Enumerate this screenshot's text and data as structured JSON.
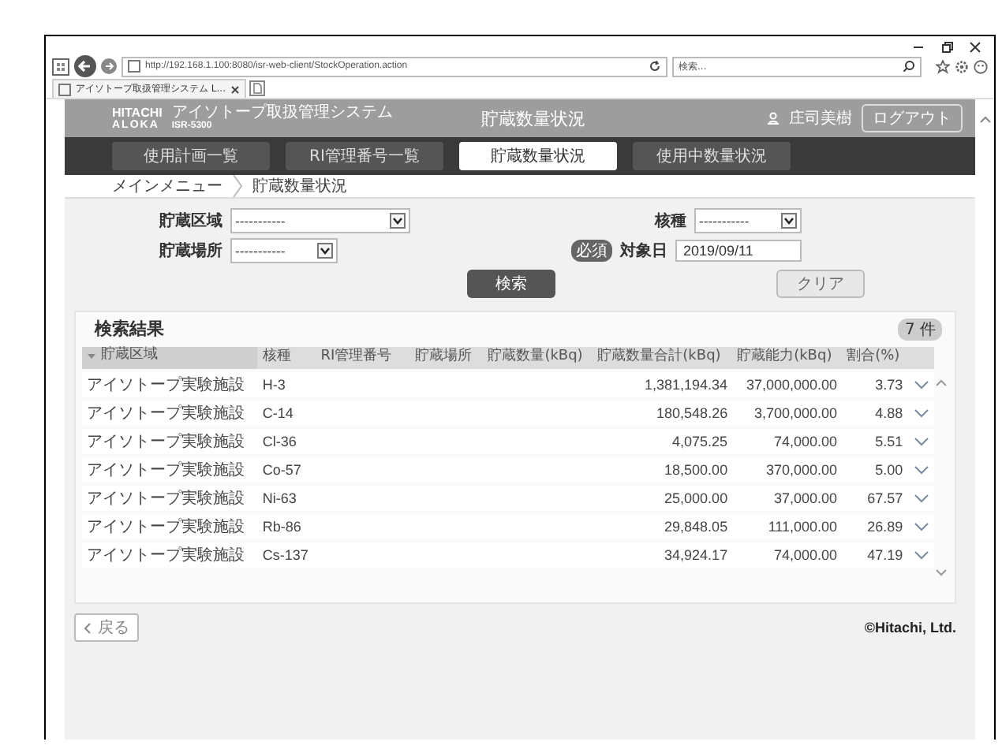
{
  "browser": {
    "url": "http://192.168.1.100:8080/isr-web-client/StockOperation.action",
    "search_placeholder": "検索...",
    "tab_title": "アイソトープ取扱管理システム L..."
  },
  "header": {
    "brand": "HITACHI",
    "sub_brand": "ALOKA",
    "system_name": "アイソトープ取扱管理システム",
    "model": "ISR-5300",
    "page_title": "貯蔵数量状況",
    "user": "庄司美樹",
    "logout": "ログアウト"
  },
  "nav": [
    {
      "label": "使用計画一覧",
      "selected": false
    },
    {
      "label": "RI管理番号一覧",
      "selected": false
    },
    {
      "label": "貯蔵数量状況",
      "selected": true
    },
    {
      "label": "使用中数量状況",
      "selected": false
    }
  ],
  "breadcrumb": [
    "メインメニュー",
    "貯蔵数量状況"
  ],
  "form": {
    "fields": [
      {
        "label": "貯蔵区域",
        "kind": "select",
        "value": "-----------",
        "wide": true
      },
      {
        "label": "核種",
        "kind": "select",
        "value": "-----------",
        "wide": false
      },
      {
        "label": "貯蔵場所",
        "kind": "select",
        "value": "-----------",
        "wide": false
      },
      {
        "label": "対象日",
        "kind": "date",
        "value": "2019/09/11",
        "badge": "必須",
        "wide": false
      }
    ],
    "search_button": "検索",
    "clear_button": "クリア"
  },
  "results": {
    "title": "検索結果",
    "count": "7 件",
    "columns": [
      "貯蔵区域",
      "核種",
      "RI管理番号",
      "貯蔵場所",
      "貯蔵数量(kBq)",
      "貯蔵数量合計(kBq)",
      "貯蔵能力(kBq)",
      "割合(%)"
    ],
    "rows": [
      {
        "area": "アイソトープ実験施設",
        "nuclide": "H-3",
        "total": "1,381,194.34",
        "capacity": "37,000,000.00",
        "ratio": "3.73"
      },
      {
        "area": "アイソトープ実験施設",
        "nuclide": "C-14",
        "total": "180,548.26",
        "capacity": "3,700,000.00",
        "ratio": "4.88"
      },
      {
        "area": "アイソトープ実験施設",
        "nuclide": "Cl-36",
        "total": "4,075.25",
        "capacity": "74,000.00",
        "ratio": "5.51"
      },
      {
        "area": "アイソトープ実験施設",
        "nuclide": "Co-57",
        "total": "18,500.00",
        "capacity": "370,000.00",
        "ratio": "5.00"
      },
      {
        "area": "アイソトープ実験施設",
        "nuclide": "Ni-63",
        "total": "25,000.00",
        "capacity": "37,000.00",
        "ratio": "67.57"
      },
      {
        "area": "アイソトープ実験施設",
        "nuclide": "Rb-86",
        "total": "29,848.05",
        "capacity": "111,000.00",
        "ratio": "26.89"
      },
      {
        "area": "アイソトープ実験施設",
        "nuclide": "Cs-137",
        "total": "34,924.17",
        "capacity": "74,000.00",
        "ratio": "47.19"
      }
    ]
  },
  "footer": {
    "back_button": "戻る",
    "copyright": "©Hitachi, Ltd."
  }
}
